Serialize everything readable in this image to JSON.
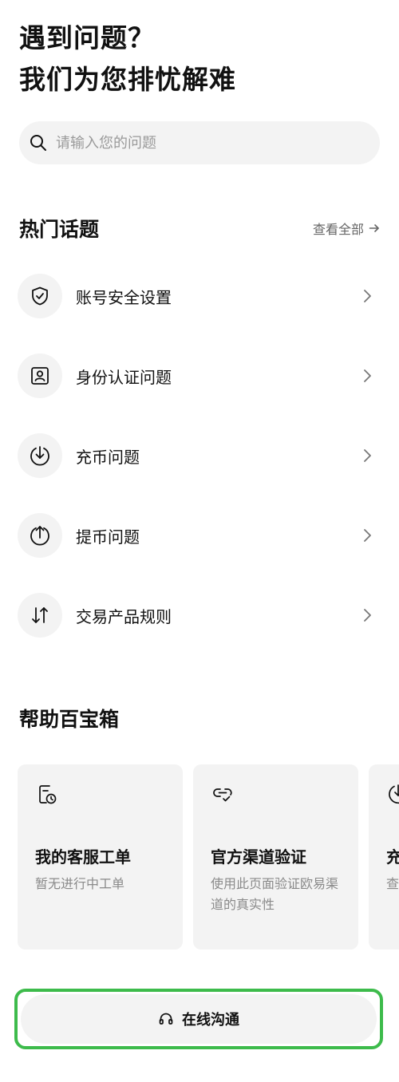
{
  "header": {
    "title_line1": "遇到问题？",
    "title_line2": "我们为您排忧解难"
  },
  "search": {
    "placeholder": "请输入您的问题",
    "icon": "search-icon"
  },
  "hot_topics": {
    "title": "热门话题",
    "view_all_label": "查看全部",
    "view_all_icon": "arrow-right-icon",
    "items": [
      {
        "label": "账号安全设置",
        "icon": "shield-check-icon"
      },
      {
        "label": "身份认证问题",
        "icon": "id-card-icon"
      },
      {
        "label": "充币问题",
        "icon": "deposit-down-icon"
      },
      {
        "label": "提币问题",
        "icon": "withdraw-up-icon"
      },
      {
        "label": "交易产品规则",
        "icon": "trade-arrows-icon"
      }
    ]
  },
  "toolbox": {
    "title": "帮助百宝箱",
    "cards": [
      {
        "title": "我的客服工单",
        "desc": "暂无进行中工单",
        "icon": "ticket-clock-icon"
      },
      {
        "title": "官方渠道验证",
        "desc": "使用此页面验证欧易渠道的真实性",
        "icon": "link-check-icon"
      },
      {
        "title": "充",
        "desc": "查",
        "icon": "deposit-down-icon"
      }
    ]
  },
  "bottom": {
    "label": "在线沟通",
    "icon": "headset-icon",
    "highlight_color": "#3dbb4b"
  }
}
